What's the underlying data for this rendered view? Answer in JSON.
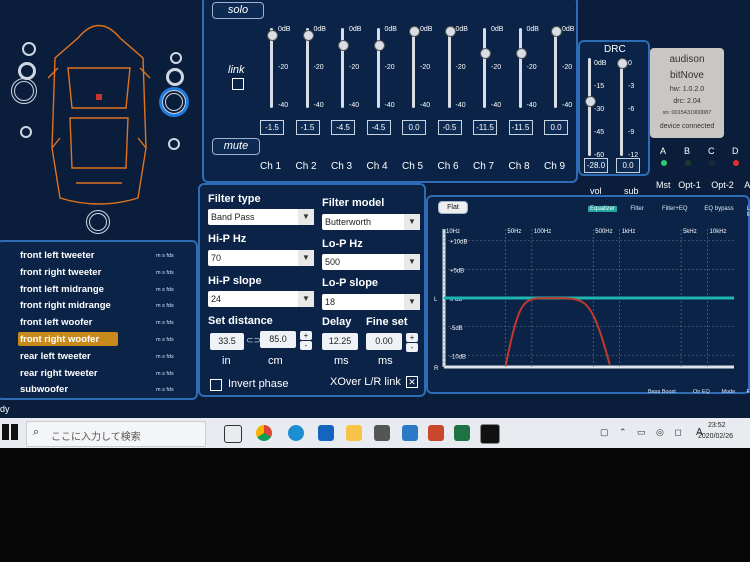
{
  "buttons": {
    "solo": "solo",
    "mute": "mute",
    "link": "link",
    "flat": "Flat"
  },
  "eq": {
    "scale": [
      "0dB",
      "-20",
      "-40"
    ],
    "channels": [
      {
        "label": "Ch 1",
        "value": "-1.5",
        "level": 0.07
      },
      {
        "label": "Ch 2",
        "value": "-1.5",
        "level": 0.07
      },
      {
        "label": "Ch 3",
        "value": "-4.5",
        "level": 0.2
      },
      {
        "label": "Ch 4",
        "value": "-4.5",
        "level": 0.2
      },
      {
        "label": "Ch 5",
        "value": "0.0",
        "level": 0.02
      },
      {
        "label": "Ch 6",
        "value": "-0.5",
        "level": 0.03
      },
      {
        "label": "Ch 7",
        "value": "-11.5",
        "level": 0.3
      },
      {
        "label": "Ch 8",
        "value": "-11.5",
        "level": 0.3
      },
      {
        "label": "Ch 9",
        "value": "0.0",
        "level": 0.02
      }
    ]
  },
  "drc": {
    "title": "DRC",
    "vol_scale": [
      "0dB",
      "-15",
      "-30",
      "-45",
      "-60"
    ],
    "sub_scale": [
      "0",
      "-3",
      "-6",
      "-9",
      "-12"
    ],
    "vol_value": "-28.0",
    "sub_value": "0.0",
    "vol_label": "vol",
    "sub_label": "sub"
  },
  "device": {
    "brand": "audison",
    "product": "bitNove",
    "hw": "hw: 1.0.2.0",
    "drc": "drc: 2.04",
    "sn": "sn: 0015431900087",
    "status": "device connected",
    "inputs": [
      "A",
      "B",
      "C",
      "D"
    ],
    "modes": [
      "Mst",
      "Opt-1",
      "Opt-2",
      "Aux"
    ]
  },
  "channels": [
    {
      "name": "front left tweeter",
      "tags": "m s fds"
    },
    {
      "name": "front right tweeter",
      "tags": "m s fds"
    },
    {
      "name": "front left midrange",
      "tags": "m s fds"
    },
    {
      "name": "front right midrange",
      "tags": "m s fds"
    },
    {
      "name": "front left woofer",
      "tags": "m s fds"
    },
    {
      "name": "front right woofer",
      "tags": "m s fds"
    },
    {
      "name": "rear left tweeter",
      "tags": "m s fds"
    },
    {
      "name": "rear right tweeter",
      "tags": "m s fds"
    },
    {
      "name": "subwoofer",
      "tags": "m s fds"
    }
  ],
  "selected_channel": "front right woofer",
  "filter": {
    "type_label": "Filter type",
    "type_value": "Band Pass",
    "model_label": "Filter model",
    "model_value": "Butterworth",
    "hip_hz_label": "Hi-P Hz",
    "hip_hz_value": "70",
    "lop_hz_label": "Lo-P Hz",
    "lop_hz_value": "500",
    "hip_slope_label": "Hi-P slope",
    "hip_slope_value": "24",
    "lop_slope_label": "Lo-P slope",
    "lop_slope_value": "18",
    "set_distance_label": "Set distance",
    "distance_in": "33.5",
    "distance_cm": "85.0",
    "unit_in": "in",
    "unit_cm": "cm",
    "delay_label": "Delay",
    "delay_value": "12.25",
    "delay_unit": "ms",
    "fine_set_label": "Fine set",
    "fine_set_value": "0.00",
    "fine_unit": "ms",
    "invert_phase_label": "Invert phase",
    "xover_link_label": "XOver L/R link"
  },
  "graph": {
    "tabs": [
      "Equalizer",
      "Filter",
      "Filter+EQ",
      "EQ bypass",
      "L/R link"
    ],
    "freq_labels": [
      "10Hz",
      "50Hz",
      "100Hz",
      "500Hz",
      "1kHz",
      "5kHz",
      "10kHz"
    ],
    "db_labels": [
      "+10dB",
      "+5dB",
      "0 dB",
      "-5dB",
      "-10dB"
    ],
    "l_label": "L",
    "r_label": "R",
    "footer": [
      "Bass Boost",
      "On EQ",
      "Mode",
      "EXP"
    ],
    "colors": {
      "eq": "#1fb5b0",
      "filter": "#c0392b"
    }
  },
  "taskbar": {
    "search_placeholder": "ここに入力して検索",
    "time": "23:52",
    "date": "2020/02/26",
    "ime": "A"
  },
  "status_left": "dy"
}
